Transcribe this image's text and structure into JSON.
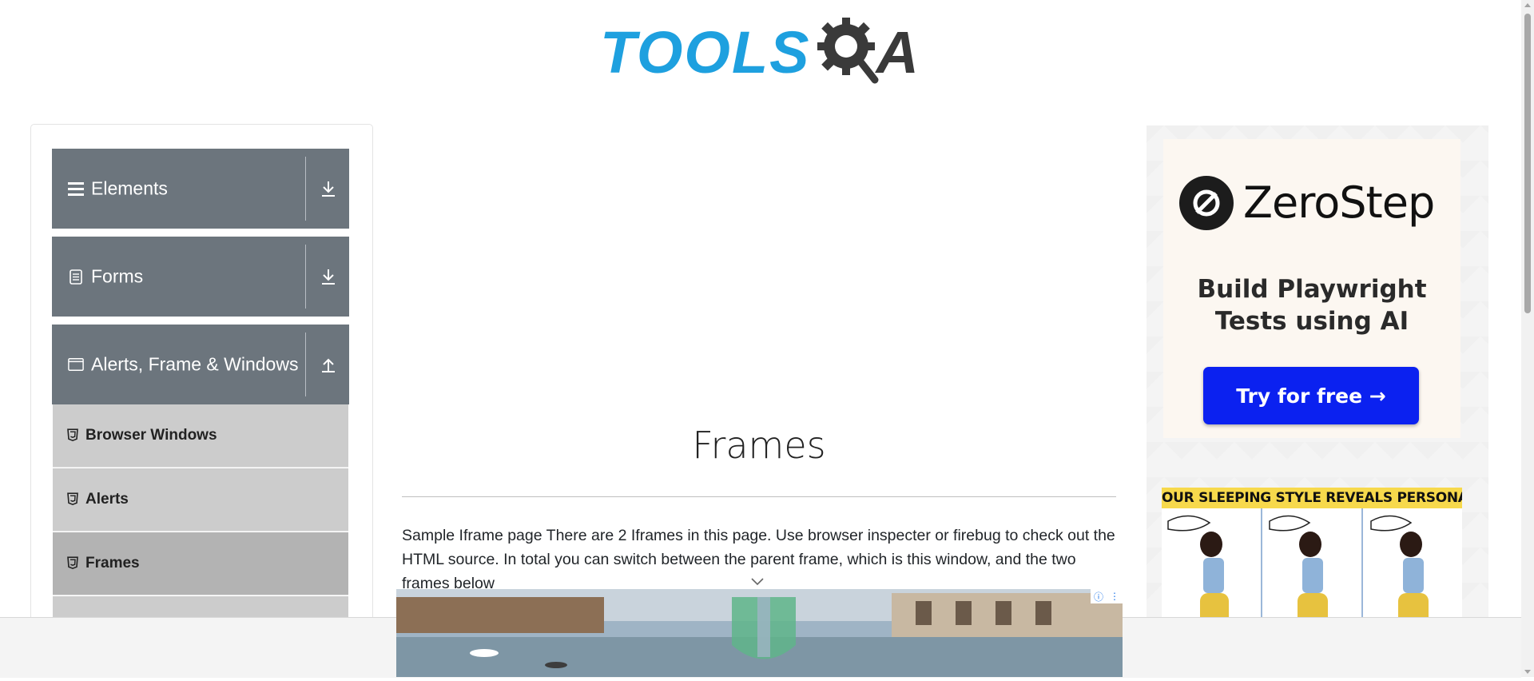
{
  "header": {
    "logo_text_left": "TOOLS",
    "logo_text_right": "A"
  },
  "sidebar": {
    "groups": [
      {
        "label": "Elements",
        "icon": "hamburger-icon",
        "toggle_icon": "download-arrow-icon"
      },
      {
        "label": "Forms",
        "icon": "document-icon",
        "toggle_icon": "download-arrow-icon"
      },
      {
        "label": "Alerts, Frame & Windows",
        "icon": "window-icon",
        "toggle_icon": "upload-arrow-icon"
      }
    ],
    "items": [
      {
        "label": "Browser Windows",
        "icon": "html5-icon"
      },
      {
        "label": "Alerts",
        "icon": "html5-icon"
      },
      {
        "label": "Frames",
        "icon": "html5-icon",
        "active": true
      }
    ]
  },
  "main": {
    "title": "Frames",
    "description": "Sample Iframe page There are 2 Iframes in this page. Use browser inspecter or firebug to check out the HTML source. In total you can switch between the parent frame, which is this window, and the two frames below"
  },
  "ad_right": {
    "brand": "ZeroStep",
    "tagline_line1": "Build Playwright",
    "tagline_line2": "Tests using AI",
    "cta": "Try for free →",
    "banner_text": "OUR SLEEPING STYLE REVEALS PERSONALIT"
  },
  "colors": {
    "sidebar_group_bg": "#6c757d",
    "sidebar_item_bg": "#cccccc",
    "sidebar_item_active_bg": "#b3b3b3",
    "logo_blue": "#1ea0df",
    "logo_dark": "#3a3a3a",
    "ad_button_blue": "#0b21f0",
    "banner_yellow": "#f7d94c"
  }
}
